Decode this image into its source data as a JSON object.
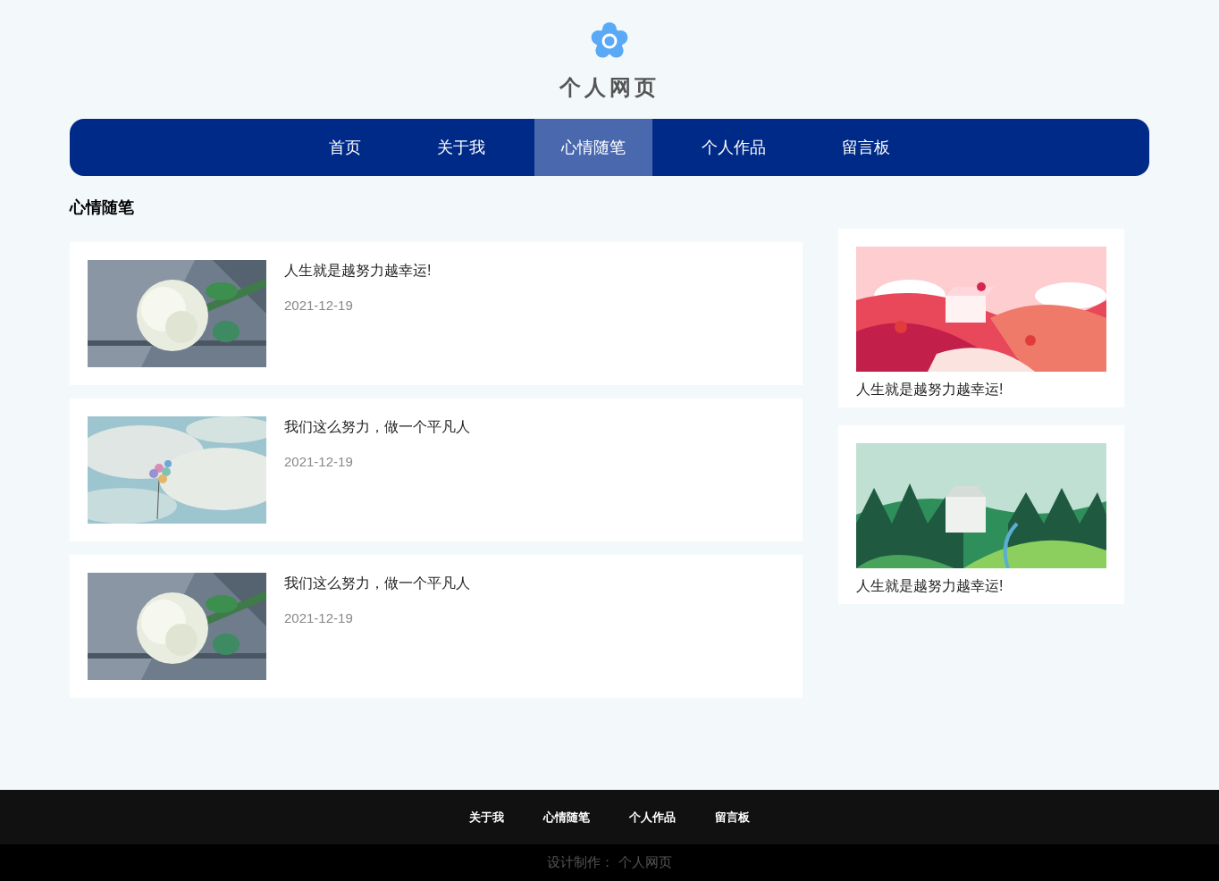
{
  "header": {
    "title": "个人网页"
  },
  "nav": [
    {
      "label": "首页",
      "selected": false
    },
    {
      "label": "关于我",
      "selected": false
    },
    {
      "label": "心情随笔",
      "selected": true
    },
    {
      "label": "个人作品",
      "selected": false
    },
    {
      "label": "留言板",
      "selected": false
    }
  ],
  "section_title": "心情随笔",
  "posts": [
    {
      "title": "人生就是越努力越幸运!",
      "date": "2021-12-19"
    },
    {
      "title": "我们这么努力，做一个平凡人",
      "date": "2021-12-19"
    },
    {
      "title": "我们这么努力，做一个平凡人",
      "date": "2021-12-19"
    }
  ],
  "side_cards": [
    {
      "caption": "人生就是越努力越幸运!"
    },
    {
      "caption": "人生就是越努力越幸运!"
    }
  ],
  "footer": {
    "links": [
      "关于我",
      "心情随笔",
      "个人作品",
      "留言板"
    ],
    "credit": "设计制作： 个人网页"
  }
}
